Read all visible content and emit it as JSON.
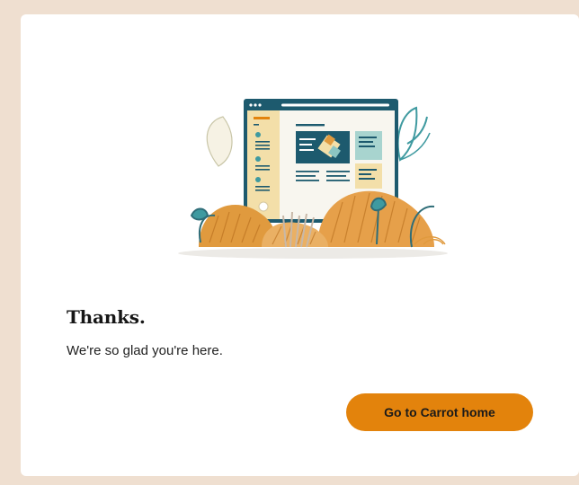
{
  "confirmation": {
    "title": "Thanks.",
    "message": "We're so glad you're here.",
    "button_label": "Go to Carrot home"
  },
  "colors": {
    "page_background": "#efdfd0",
    "card_background": "#ffffff",
    "accent": "#e3830c",
    "illustration_teal": "#1d5a6e",
    "illustration_orange": "#e09a3e"
  }
}
